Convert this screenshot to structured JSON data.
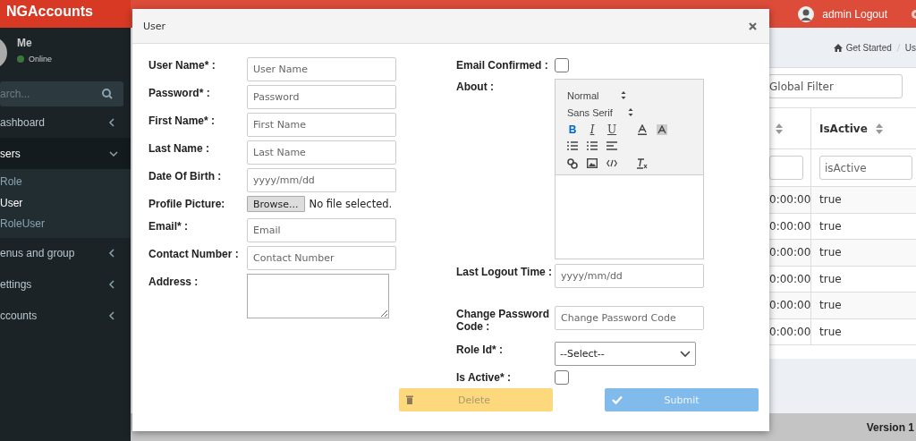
{
  "sidebar": {
    "logo": "NGAccounts",
    "user": {
      "name": "Me",
      "status": "Online"
    },
    "search": {
      "placeholder": "arch..."
    },
    "items": [
      {
        "label": "ashboard",
        "expanded": false
      },
      {
        "label": "sers",
        "expanded": true,
        "children": [
          {
            "label": "Role",
            "selected": false
          },
          {
            "label": "User",
            "selected": true
          },
          {
            "label": "RoleUser",
            "selected": false
          }
        ]
      },
      {
        "label": "enus and group",
        "expanded": false
      },
      {
        "label": "ettings",
        "expanded": false
      },
      {
        "label": "ccounts",
        "expanded": false
      }
    ]
  },
  "topbar": {
    "user": "admin Logout"
  },
  "breadcrumb": [
    "Get Started",
    "Us"
  ],
  "global_filter": {
    "placeholder": "Global Filter"
  },
  "table": {
    "columns": [
      {
        "sortable": true
      },
      {
        "label": "IsActive",
        "sortable": true,
        "filter_placeholder": "isActive"
      }
    ],
    "rows": [
      [
        "0:00:00",
        "true"
      ],
      [
        "0:00:00",
        "true"
      ],
      [
        "0:00:00",
        "true"
      ],
      [
        "0:00:00",
        "true"
      ],
      [
        "0:00:00",
        "true"
      ],
      [
        "0:00:00",
        "true"
      ]
    ]
  },
  "footer": {
    "version": "Version 1"
  },
  "dialog": {
    "title": "User",
    "left_fields": [
      {
        "kind": "text",
        "label": "User Name* :",
        "placeholder": "User Name"
      },
      {
        "kind": "text",
        "label": "Password* :",
        "placeholder": "Password"
      },
      {
        "kind": "text",
        "label": "First Name* :",
        "placeholder": "First Name"
      },
      {
        "kind": "text",
        "label": "Last Name :",
        "placeholder": "Last Name"
      },
      {
        "kind": "text",
        "label": "Date Of Birth :",
        "placeholder": "yyyy/mm/dd"
      },
      {
        "kind": "file",
        "label": "Profile Picture:",
        "button": "Browse...",
        "value": "No file selected."
      },
      {
        "kind": "text",
        "label": "Email* :",
        "placeholder": "Email"
      },
      {
        "kind": "text",
        "label": "Contact Number :",
        "placeholder": "Contact Number"
      },
      {
        "kind": "textarea",
        "label": "Address :"
      }
    ],
    "right_fields": [
      {
        "kind": "checkbox",
        "label": "Email Confirmed :",
        "checked": false
      },
      {
        "kind": "editor",
        "label": "About :",
        "header": "Normal",
        "font": "Sans Serif",
        "format_buttons": [
          {
            "label": "B",
            "active": true
          },
          {
            "label": "I",
            "active": false
          },
          {
            "label": "U",
            "active": false
          }
        ]
      },
      {
        "kind": "text",
        "label": "Last Logout Time :",
        "placeholder": "yyyy/mm/dd"
      },
      {
        "kind": "text",
        "label": "Change Password Code :",
        "placeholder": "Change Password Code"
      },
      {
        "kind": "select",
        "label": "Role Id* :",
        "value": "--Select--"
      },
      {
        "kind": "checkbox",
        "label": "Is Active* :",
        "checked": false
      }
    ],
    "buttons": [
      {
        "kind": "delete",
        "label": "Delete",
        "disabled": true
      },
      {
        "kind": "submit",
        "label": "Submit",
        "disabled": true
      }
    ]
  }
}
